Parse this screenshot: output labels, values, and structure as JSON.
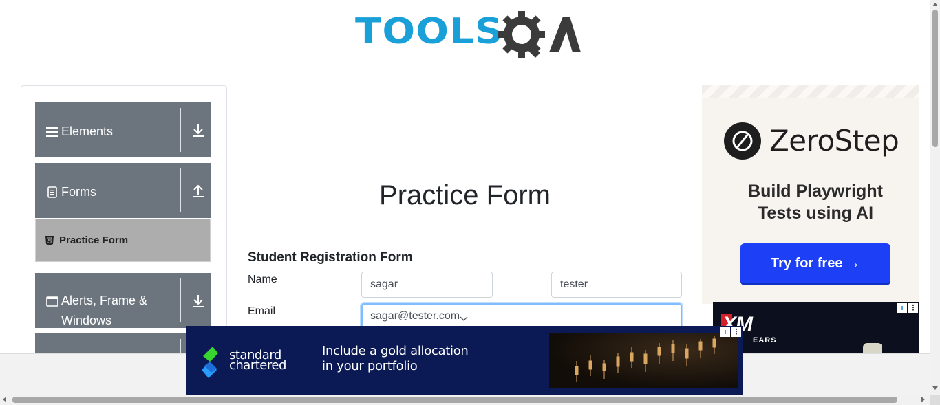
{
  "logo": {
    "text_tools": "TOOLS",
    "text_qa": "QA"
  },
  "sidebar": {
    "groups": [
      {
        "label": "Elements",
        "icon": "hamburger-icon",
        "arrow": "download-arrow-icon"
      },
      {
        "label": "Forms",
        "icon": "document-icon",
        "arrow": "upload-arrow-icon"
      },
      {
        "label": "Alerts, Frame & Windows",
        "icon": "window-icon",
        "arrow": "download-arrow-icon"
      }
    ],
    "sub_items": [
      {
        "label": "Practice Form",
        "icon": "html5-icon",
        "active": true
      }
    ]
  },
  "main": {
    "title": "Practice Form",
    "form_heading": "Student Registration Form",
    "fields": {
      "name_label": "Name",
      "first_name": "sagar",
      "last_name": "tester",
      "email_label": "Email",
      "email": "sagar@tester.com"
    }
  },
  "ad_right": {
    "brand": "ZeroStep",
    "tagline": "Build Playwright Tests using AI",
    "cta": "Try for free →",
    "colors": {
      "button": "#1d3ff5",
      "background": "#f7f3ef"
    }
  },
  "ad_xm": {
    "logo": "XM",
    "sub": "EARS"
  },
  "banner_ad": {
    "brand_line1": "standard",
    "brand_line2": "chartered",
    "copy_line1": "Include a gold allocation",
    "copy_line2": "in your portfolio",
    "colors": {
      "background": "#0b1a55"
    }
  },
  "adchoices": {
    "info": "i",
    "menu": "⋮"
  }
}
